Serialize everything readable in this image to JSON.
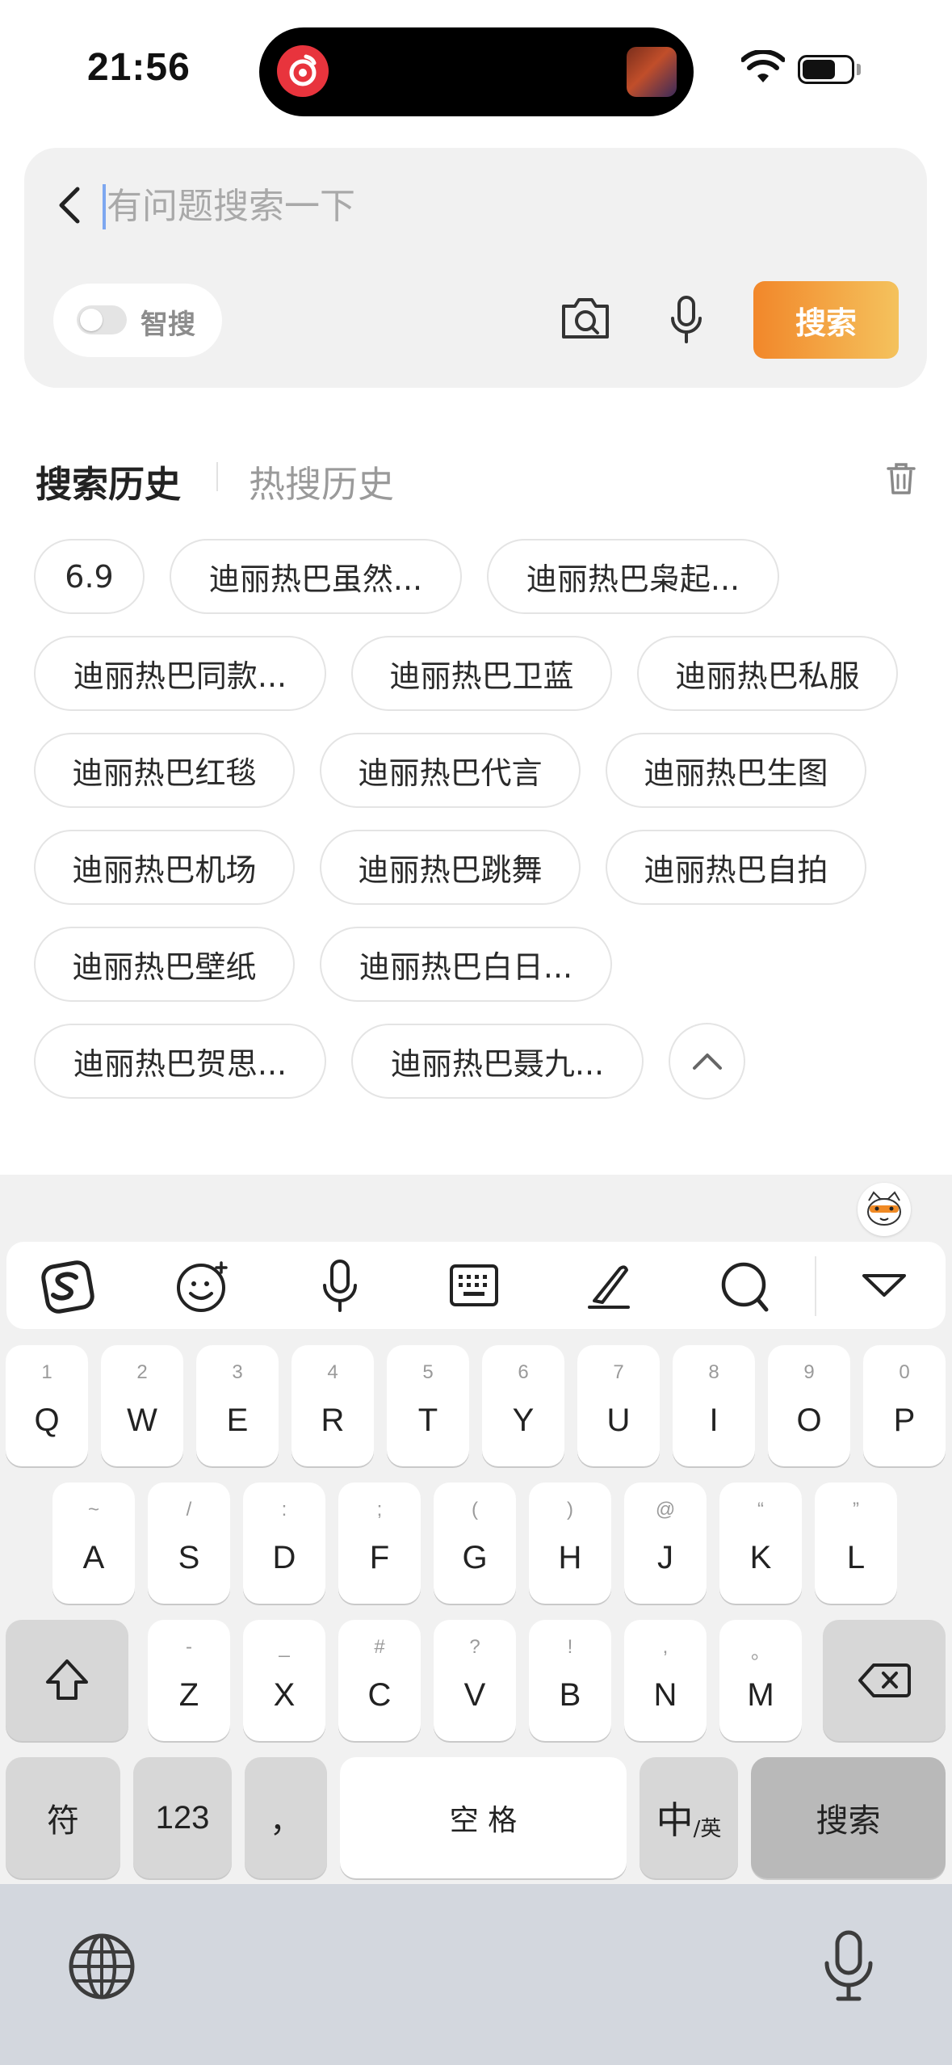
{
  "status_bar": {
    "time": "21:56"
  },
  "search": {
    "placeholder": "有问题搜索一下",
    "smart_search_label": "智搜",
    "search_button": "搜索"
  },
  "history": {
    "tab_active": "搜索历史",
    "tab_inactive": "热搜历史",
    "chips": [
      "6.9",
      "迪丽热巴虽然...",
      "迪丽热巴枭起...",
      "迪丽热巴同款...",
      "迪丽热巴卫蓝",
      "迪丽热巴私服",
      "迪丽热巴红毯",
      "迪丽热巴代言",
      "迪丽热巴生图",
      "迪丽热巴机场",
      "迪丽热巴跳舞",
      "迪丽热巴自拍",
      "迪丽热巴壁纸",
      "迪丽热巴白日...",
      "迪丽热巴贺思...",
      "迪丽热巴聂九..."
    ]
  },
  "keyboard": {
    "row1": [
      {
        "k": "Q",
        "s": "1"
      },
      {
        "k": "W",
        "s": "2"
      },
      {
        "k": "E",
        "s": "3"
      },
      {
        "k": "R",
        "s": "4"
      },
      {
        "k": "T",
        "s": "5"
      },
      {
        "k": "Y",
        "s": "6"
      },
      {
        "k": "U",
        "s": "7"
      },
      {
        "k": "I",
        "s": "8"
      },
      {
        "k": "O",
        "s": "9"
      },
      {
        "k": "P",
        "s": "0"
      }
    ],
    "row2": [
      {
        "k": "A",
        "s": "~"
      },
      {
        "k": "S",
        "s": "/"
      },
      {
        "k": "D",
        "s": ":"
      },
      {
        "k": "F",
        "s": ";"
      },
      {
        "k": "G",
        "s": "("
      },
      {
        "k": "H",
        "s": ")"
      },
      {
        "k": "J",
        "s": "@"
      },
      {
        "k": "K",
        "s": "“"
      },
      {
        "k": "L",
        "s": "”"
      }
    ],
    "row3": [
      {
        "k": "Z",
        "s": "-"
      },
      {
        "k": "X",
        "s": "_"
      },
      {
        "k": "C",
        "s": "#"
      },
      {
        "k": "V",
        "s": "?"
      },
      {
        "k": "B",
        "s": "!"
      },
      {
        "k": "N",
        "s": ","
      },
      {
        "k": "M",
        "s": "。"
      }
    ],
    "symbols_key": "符",
    "numbers_key": "123",
    "comma_key": "，",
    "space_key": "空 格",
    "lang_key_main": "中",
    "lang_key_sub": "/英",
    "search_key": "搜索"
  }
}
